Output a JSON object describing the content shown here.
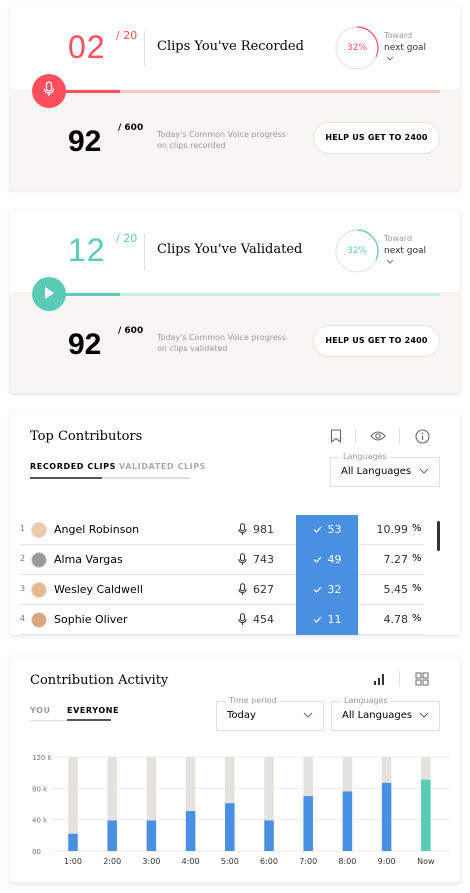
{
  "record_card": {
    "count": "02",
    "goal": "/ 20",
    "title": "Clips You've Recorded",
    "ring_percent": "32%",
    "ring_fraction": 0.32,
    "toward": "Toward",
    "next_goal": "next goal",
    "progress_fraction": 0.2,
    "total": "92",
    "total_goal": "/ 600",
    "today_text": "Today's Common Voice progress on clips recorded",
    "help_label": "HELP US GET TO 2400",
    "accent": "#ff4f5e",
    "track": "#f9c6ca",
    "icon": "microphone-icon"
  },
  "validate_card": {
    "count": "12",
    "goal": "/ 20",
    "title": "Clips You've Validated",
    "ring_percent": "32%",
    "ring_fraction": 0.32,
    "toward": "Toward",
    "next_goal": "next goal",
    "progress_fraction": 0.2,
    "total": "92",
    "total_goal": "/ 600",
    "today_text": "Today's Common Voice progress on clips validated",
    "help_label": "HELP US GET TO 2400",
    "accent": "#59cbb7",
    "track": "#c8ece6",
    "icon": "play-icon"
  },
  "contributors": {
    "title": "Top Contributors",
    "tabs": [
      "RECORDED CLIPS",
      "VALIDATED CLIPS"
    ],
    "languages_label": "Languages",
    "languages_value": "All Languages",
    "rows": [
      {
        "rank": "1",
        "name": "Angel Robinson",
        "recorded": "981",
        "validated": "53",
        "percent": "10.99",
        "pct_sign": "%"
      },
      {
        "rank": "2",
        "name": "Alma Vargas",
        "recorded": "743",
        "validated": "49",
        "percent": "7.27",
        "pct_sign": "%"
      },
      {
        "rank": "3",
        "name": "Wesley Caldwell",
        "recorded": "627",
        "validated": "32",
        "percent": "5.45",
        "pct_sign": "%"
      },
      {
        "rank": "4",
        "name": "Sophie Oliver",
        "recorded": "454",
        "validated": "11",
        "percent": "4.78",
        "pct_sign": "%"
      }
    ]
  },
  "activity": {
    "title": "Contribution Activity",
    "tabs": [
      "YOU",
      "EVERYONE"
    ],
    "time_label": "Time period",
    "time_value": "Today",
    "languages_label": "Languages",
    "languages_value": "All Languages"
  },
  "chart_data": {
    "type": "bar",
    "categories": [
      "1:00",
      "2:00",
      "3:00",
      "4:00",
      "5:00",
      "6:00",
      "7:00",
      "8:00",
      "9:00",
      "Now"
    ],
    "values": [
      22,
      39,
      39,
      51,
      61,
      39,
      70,
      76,
      87,
      91
    ],
    "ylim": [
      0,
      120
    ],
    "yticks": [
      "00",
      "40 k",
      "80 k",
      "120 k"
    ],
    "ytick_values": [
      0,
      40,
      80,
      120
    ],
    "colors": {
      "bar": "#4a90e2",
      "now": "#59cbb7",
      "background": "#e4e2de"
    }
  }
}
